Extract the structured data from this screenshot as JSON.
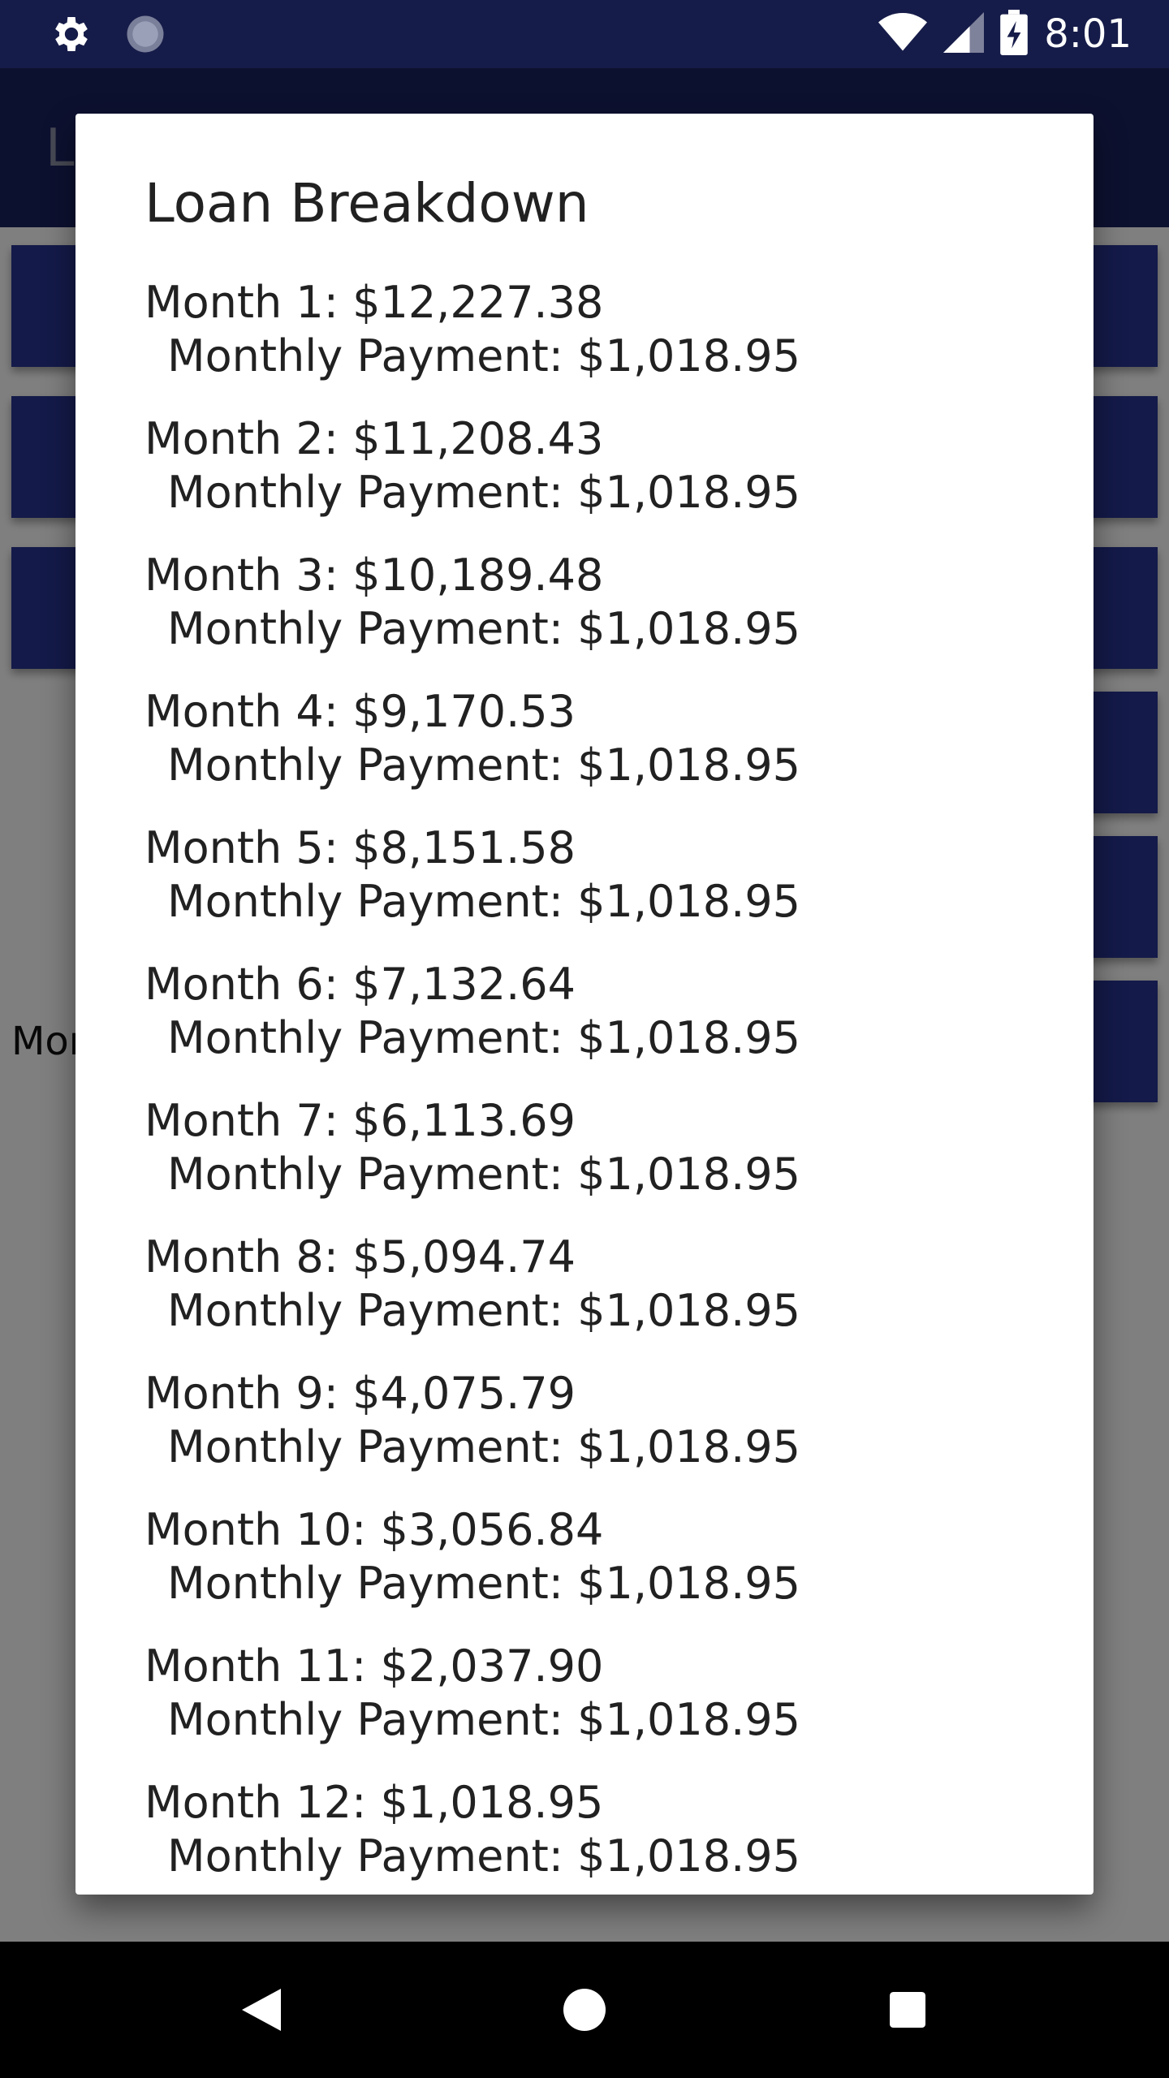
{
  "status_bar": {
    "time": "8:01",
    "icons": [
      "settings-icon",
      "sync-icon",
      "wifi-icon",
      "cell-signal-icon",
      "battery-charging-icon"
    ]
  },
  "app_bar": {
    "title_partial": "L"
  },
  "background": {
    "label_partial": "Mor"
  },
  "dialog": {
    "title": "Loan Breakdown",
    "rows": [
      {
        "month": "Month 1: $12,227.38",
        "payment": "Monthly Payment: $1,018.95"
      },
      {
        "month": "Month 2: $11,208.43",
        "payment": "Monthly Payment: $1,018.95"
      },
      {
        "month": "Month 3: $10,189.48",
        "payment": "Monthly Payment: $1,018.95"
      },
      {
        "month": "Month 4: $9,170.53",
        "payment": "Monthly Payment: $1,018.95"
      },
      {
        "month": "Month 5: $8,151.58",
        "payment": "Monthly Payment: $1,018.95"
      },
      {
        "month": "Month 6: $7,132.64",
        "payment": "Monthly Payment: $1,018.95"
      },
      {
        "month": "Month 7: $6,113.69",
        "payment": "Monthly Payment: $1,018.95"
      },
      {
        "month": "Month 8: $5,094.74",
        "payment": "Monthly Payment: $1,018.95"
      },
      {
        "month": "Month 9: $4,075.79",
        "payment": "Monthly Payment: $1,018.95"
      },
      {
        "month": "Month 10: $3,056.84",
        "payment": "Monthly Payment: $1,018.95"
      },
      {
        "month": "Month 11: $2,037.90",
        "payment": "Monthly Payment: $1,018.95"
      },
      {
        "month": "Month 12: $1,018.95",
        "payment": "Monthly Payment: $1,018.95"
      }
    ]
  },
  "nav_bar": {
    "icons": [
      "back-icon",
      "home-icon",
      "recents-icon"
    ]
  },
  "colors": {
    "status_bar": "#161c49",
    "app_bar": "#1b2260",
    "button": "#283593",
    "scrim": "rgba(0,0,0,0.5)"
  }
}
